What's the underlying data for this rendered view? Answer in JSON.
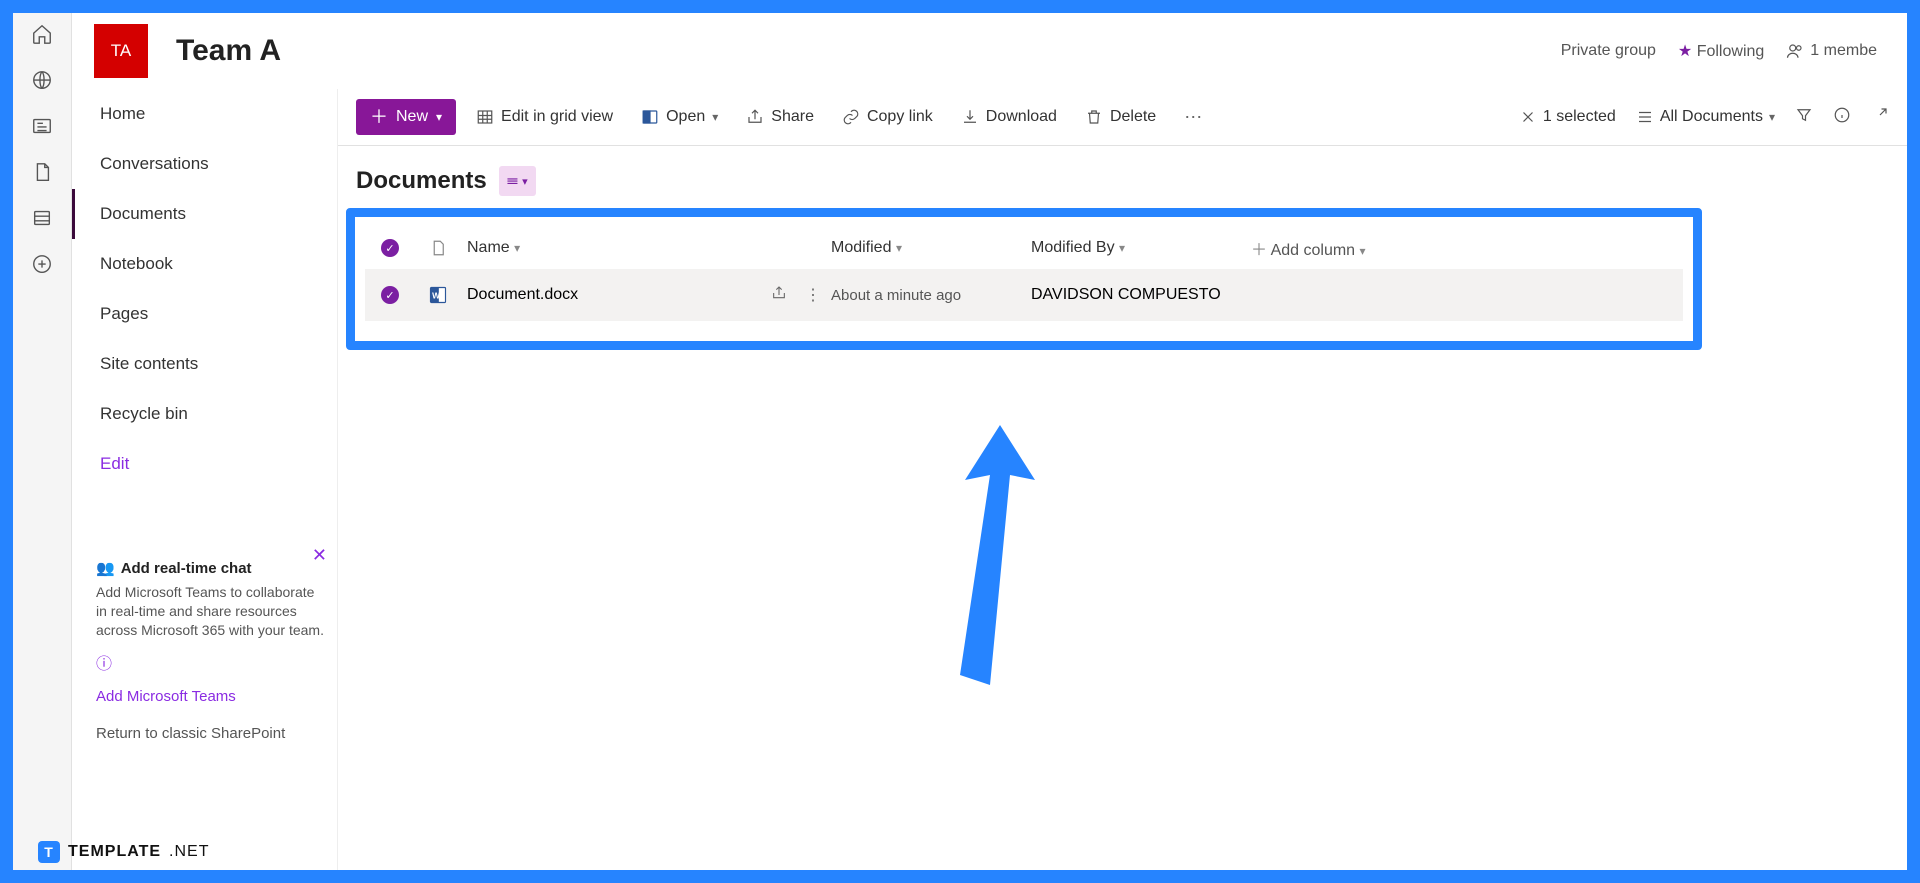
{
  "rail": {
    "icons": [
      "home",
      "globe",
      "news",
      "file",
      "list",
      "plus"
    ]
  },
  "header": {
    "logo_initials": "TA",
    "team_name": "Team A",
    "privacy": "Private group",
    "following": "Following",
    "members": "1 membe"
  },
  "nav": {
    "items": [
      {
        "label": "Home"
      },
      {
        "label": "Conversations"
      },
      {
        "label": "Documents",
        "active": true
      },
      {
        "label": "Notebook"
      },
      {
        "label": "Pages"
      },
      {
        "label": "Site contents"
      },
      {
        "label": "Recycle bin"
      }
    ],
    "edit_label": "Edit",
    "teams_card": {
      "title": "Add real-time chat",
      "desc": "Add Microsoft Teams to collaborate in real-time and share resources across Microsoft 365 with your team.",
      "link": "Add Microsoft Teams"
    },
    "classic": "Return to classic SharePoint"
  },
  "toolbar": {
    "new": "New",
    "grid": "Edit in grid view",
    "open": "Open",
    "share": "Share",
    "copy": "Copy link",
    "download": "Download",
    "delete": "Delete",
    "selected": "1 selected",
    "view": "All Documents"
  },
  "section": {
    "title": "Documents"
  },
  "table": {
    "headers": {
      "name": "Name",
      "modified": "Modified",
      "modified_by": "Modified By",
      "add": "Add column"
    },
    "rows": [
      {
        "name": "Document.docx",
        "modified": "About a minute ago",
        "by": "DAVIDSON COMPUESTO"
      }
    ]
  },
  "watermark": {
    "brand": "TEMPLATE",
    "suffix": ".NET"
  }
}
